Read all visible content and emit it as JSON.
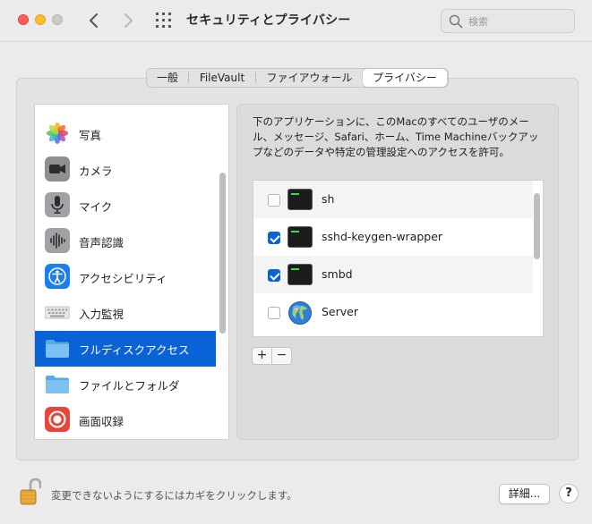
{
  "window": {
    "title": "セキュリティとプライバシー"
  },
  "search": {
    "placeholder": "検索"
  },
  "tabs": [
    {
      "label": "一般",
      "active": false
    },
    {
      "label": "FileVault",
      "active": false
    },
    {
      "label": "ファイアウォール",
      "active": false
    },
    {
      "label": "プライバシー",
      "active": true
    }
  ],
  "sidebar": {
    "items": [
      {
        "label": "写真",
        "icon": "photos-icon"
      },
      {
        "label": "カメラ",
        "icon": "camera-icon"
      },
      {
        "label": "マイク",
        "icon": "microphone-icon"
      },
      {
        "label": "音声認識",
        "icon": "speech-recognition-icon"
      },
      {
        "label": "アクセシビリティ",
        "icon": "accessibility-icon"
      },
      {
        "label": "入力監視",
        "icon": "keyboard-icon"
      },
      {
        "label": "フルディスクアクセス",
        "icon": "folder-icon",
        "selected": true
      },
      {
        "label": "ファイルとフォルダ",
        "icon": "folder-icon"
      },
      {
        "label": "画面収録",
        "icon": "screen-recording-icon"
      }
    ]
  },
  "right": {
    "description": "下のアプリケーションに、このMacのすべてのユーザのメール、メッセージ、Safari、ホーム、Time Machineバックアップなどのデータや特定の管理設定へのアクセスを許可。",
    "apps": [
      {
        "name": "sh",
        "checked": false,
        "icon": "terminal-icon"
      },
      {
        "name": "sshd-keygen-wrapper",
        "checked": true,
        "icon": "terminal-icon"
      },
      {
        "name": "smbd",
        "checked": true,
        "icon": "terminal-icon"
      },
      {
        "name": "Server",
        "checked": false,
        "icon": "globe-icon"
      }
    ],
    "add_label": "+",
    "remove_label": "−"
  },
  "footer": {
    "lock_text": "変更できないようにするにはカギをクリックします。",
    "details_label": "詳細...",
    "help_label": "?"
  },
  "colors": {
    "accent": "#0a63d6",
    "close": "#ff5f57",
    "minimize": "#febc2e"
  }
}
